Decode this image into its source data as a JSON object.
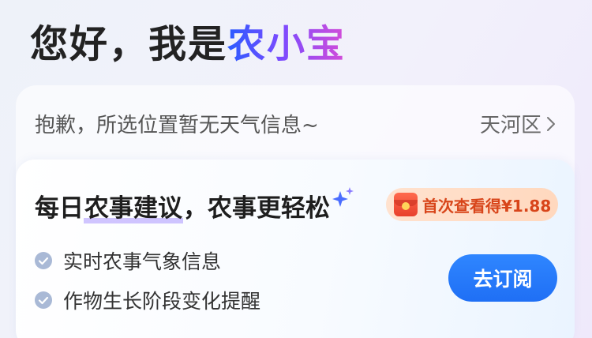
{
  "greeting": {
    "prefix": "您好，我是",
    "brand": "农小宝"
  },
  "weather": {
    "message": "抱歉，所选位置暂无天气信息~",
    "location": "天河区"
  },
  "promo": {
    "title_pre": "每日",
    "title_highlight": "农事建议",
    "title_post": "，农事更轻松",
    "badge_text": "首次查看得¥1.88",
    "features": [
      "实时农事气象信息",
      "作物生长阶段变化提醒"
    ],
    "subscribe_label": "去订阅"
  },
  "colors": {
    "accent_blue": "#2f86ff",
    "badge_text": "#d8451a",
    "check_icon": "#a8b8d8"
  },
  "icons": {
    "chevron": "chevron-right-icon",
    "sparkle": "sparkle-icon",
    "envelope": "red-envelope-icon",
    "check": "check-circle-icon"
  }
}
